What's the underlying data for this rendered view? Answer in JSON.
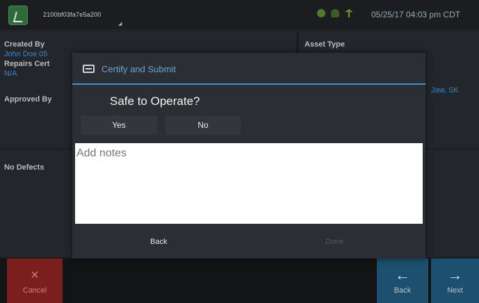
{
  "status_bar": {
    "device_id": "2100bf03fa7e5a200",
    "datetime": "05/25/17 04:03 pm CDT"
  },
  "background": {
    "created_by_label": "Created By",
    "created_by_value": "John Doe 05",
    "repairs_cert_label": "Repairs Cert",
    "repairs_cert_value": "N/A",
    "approved_by_label": "Approved By",
    "no_defects_label": "No Defects",
    "asset_type_label": "Asset Type",
    "location_value": "Jaw, SK"
  },
  "bottom_bar": {
    "cancel_icon": "×",
    "cancel_label": "Cancel",
    "back_icon": "←",
    "back_label": "Back",
    "next_icon": "→",
    "next_label": "Next"
  },
  "dialog": {
    "title": "Certify and Submit",
    "question": "Safe to Operate?",
    "yes_label": "Yes",
    "no_label": "No",
    "notes_placeholder": "Add notes",
    "notes_value": "",
    "back_label": "Back",
    "done_label": "Done"
  },
  "colors": {
    "accent": "#3d97d3",
    "cancel": "#7a1e1e",
    "nav": "#1d4f6e"
  }
}
